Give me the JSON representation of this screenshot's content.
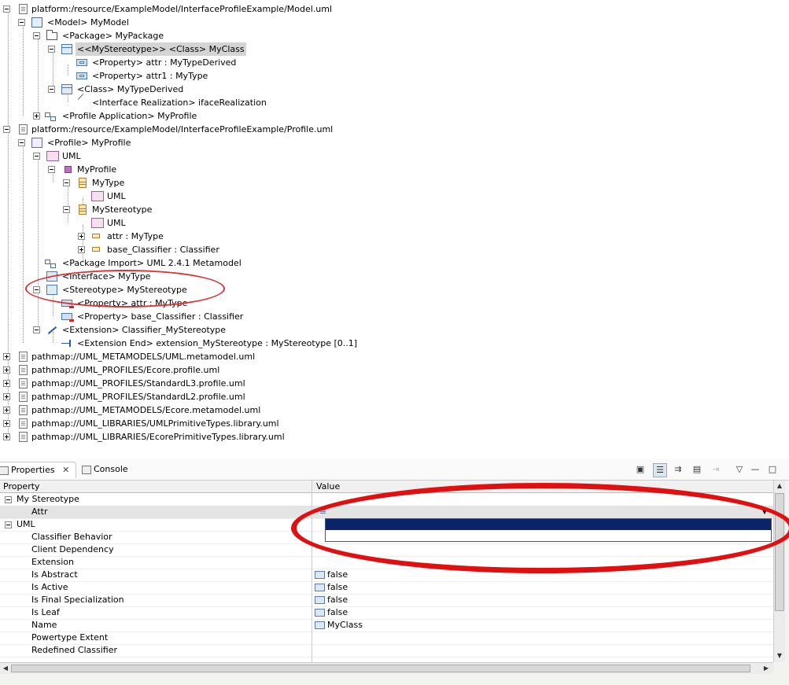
{
  "tree": {
    "nodes": [
      {
        "label": "platform:/resource/ExampleModel/InterfaceProfileExample/Model.uml",
        "icon": "file-icon"
      },
      {
        "label": "<Model> MyModel",
        "icon": "model-icon"
      },
      {
        "label": "<Package> MyPackage",
        "icon": "package-icon"
      },
      {
        "label": "<<MyStereotype>> <Class> MyClass",
        "icon": "class-icon"
      },
      {
        "label": "<Property> attr : MyTypeDerived",
        "icon": "property-icon"
      },
      {
        "label": "<Property> attr1 : MyType",
        "icon": "property-icon"
      },
      {
        "label": "<Class> MyTypeDerived",
        "icon": "class-icon"
      },
      {
        "label": "<Interface Realization> ifaceRealization",
        "icon": "interface-realization-icon"
      },
      {
        "label": "<Profile Application> MyProfile",
        "icon": "profile-application-icon"
      },
      {
        "label": "platform:/resource/ExampleModel/InterfaceProfileExample/Profile.uml",
        "icon": "file-icon"
      },
      {
        "label": "<Profile> MyProfile",
        "icon": "profile-icon"
      },
      {
        "label": "UML",
        "icon": "uml-annotation-icon"
      },
      {
        "label": "MyProfile",
        "icon": "stereotype-icon"
      },
      {
        "label": "MyType",
        "icon": "datatype-icon"
      },
      {
        "label": "UML",
        "icon": "uml-annotation-icon"
      },
      {
        "label": "MyStereotype",
        "icon": "datatype-icon"
      },
      {
        "label": "UML",
        "icon": "uml-annotation-icon"
      },
      {
        "label": "attr : MyType",
        "icon": "attribute-icon"
      },
      {
        "label": "base_Classifier : Classifier",
        "icon": "attribute-icon"
      },
      {
        "label": "<Package Import> UML 2.4.1 Metamodel",
        "icon": "package-import-icon"
      },
      {
        "label": "<Interface> MyType",
        "icon": "interface-icon"
      },
      {
        "label": "<Stereotype> MyStereotype",
        "icon": "stereotype-class-icon"
      },
      {
        "label": "<Property> attr : MyType",
        "icon": "property-red-icon"
      },
      {
        "label": "<Property> base_Classifier : Classifier",
        "icon": "property-red-icon"
      },
      {
        "label": "<Extension> Classifier_MyStereotype",
        "icon": "extension-icon"
      },
      {
        "label": "<Extension End> extension_MyStereotype : MyStereotype [0..1]",
        "icon": "extension-end-icon"
      },
      {
        "label": "pathmap://UML_METAMODELS/UML.metamodel.uml",
        "icon": "file-icon"
      },
      {
        "label": "pathmap://UML_PROFILES/Ecore.profile.uml",
        "icon": "file-icon"
      },
      {
        "label": "pathmap://UML_PROFILES/StandardL3.profile.uml",
        "icon": "file-icon"
      },
      {
        "label": "pathmap://UML_PROFILES/StandardL2.profile.uml",
        "icon": "file-icon"
      },
      {
        "label": "pathmap://UML_METAMODELS/Ecore.metamodel.uml",
        "icon": "file-icon"
      },
      {
        "label": "pathmap://UML_LIBRARIES/UMLPrimitiveTypes.library.uml",
        "icon": "file-icon"
      },
      {
        "label": "pathmap://UML_LIBRARIES/EcorePrimitiveTypes.library.uml",
        "icon": "file-icon"
      }
    ]
  },
  "tabs": {
    "properties": "Properties",
    "console": "Console"
  },
  "grid": {
    "header_property": "Property",
    "header_value": "Value",
    "rows": [
      {
        "name": "My Stereotype",
        "value": ""
      },
      {
        "name": "Attr",
        "value": ""
      },
      {
        "name": "UML",
        "value": ""
      },
      {
        "name": "Classifier Behavior",
        "value": ""
      },
      {
        "name": "Client Dependency",
        "value": ""
      },
      {
        "name": "Extension",
        "value": ""
      },
      {
        "name": "Is Abstract",
        "value": "false"
      },
      {
        "name": "Is Active",
        "value": "false"
      },
      {
        "name": "Is Final Specialization",
        "value": "false"
      },
      {
        "name": "Is Leaf",
        "value": "false"
      },
      {
        "name": "Name",
        "value": "MyClass"
      },
      {
        "name": "Powertype Extent",
        "value": ""
      },
      {
        "name": "Redefined Classifier",
        "value": ""
      }
    ]
  },
  "colors": {
    "selection": "#0a246a",
    "highlight_ellipse": "#e01010"
  }
}
